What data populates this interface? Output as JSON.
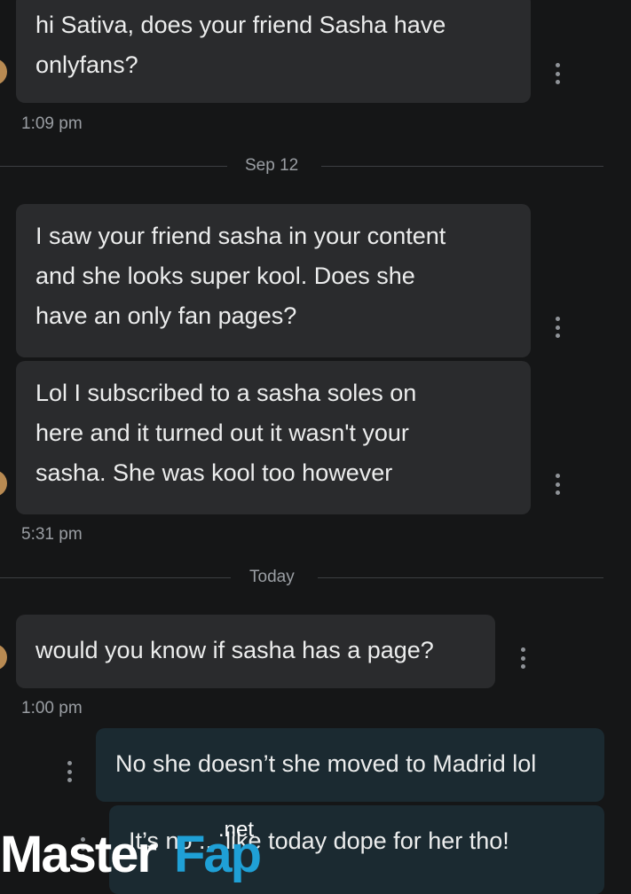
{
  "messages": [
    {
      "direction": "incoming",
      "lines": [
        "hi Sativa, does your friend Sasha have",
        "onlyfans?"
      ]
    },
    {
      "direction": "incoming",
      "lines": [
        "I saw your friend sasha in your content",
        "and she looks super kool. Does she",
        "have an only fan pages?"
      ]
    },
    {
      "direction": "incoming",
      "lines": [
        "Lol I subscribed to a sasha soles on",
        "here and it turned out it wasn't your",
        "sasha. She was kool too however"
      ]
    },
    {
      "direction": "incoming",
      "lines": [
        "would you know if sasha has a page?"
      ]
    },
    {
      "direction": "outgoing",
      "lines": [
        "No she doesn’t she moved to Madrid lol"
      ]
    },
    {
      "direction": "outgoing",
      "lines": [
        "It’s no ... like today dope for her tho!"
      ]
    }
  ],
  "timestamps": [
    "1:09 pm",
    "5:31 pm",
    "1:00 pm"
  ],
  "dividers": [
    "Sep 12",
    "Today"
  ],
  "watermark": {
    "master": "Master",
    "fap": "Fap",
    "net": ".net"
  },
  "colors": {
    "background": "#151617",
    "incoming_bubble": "#2a2b2d",
    "outgoing_bubble": "#1b2a31",
    "watermark_accent": "#1fa0d6"
  }
}
